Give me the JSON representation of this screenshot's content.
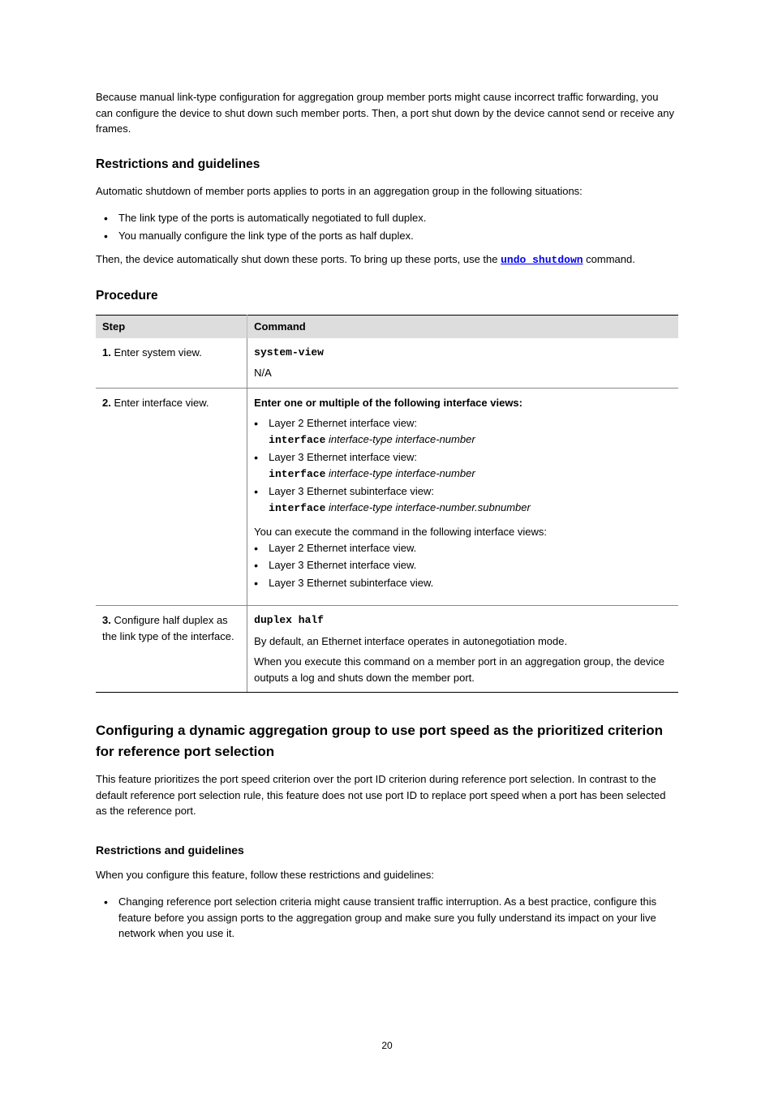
{
  "intro": "Because manual link-type configuration for aggregation group member ports might cause incorrect traffic forwarding, you can configure the device to shut down such member ports. Then, a port shut down by the device cannot send or receive any frames.",
  "section1": {
    "title": "Restrictions and guidelines",
    "para1": "Automatic shutdown of member ports applies to ports in an aggregation group in the following situations:",
    "bullets": [
      "The link type of the ports is automatically negotiated to full duplex.",
      "You manually configure the link type of the ports as half duplex."
    ],
    "after_prefix": "Then, the device automatically shut down these ports. To bring up these ports, use the ",
    "after_cmd": "undo shutdown",
    "after_suffix": " command."
  },
  "section2": {
    "title": "Procedure",
    "table": {
      "col1": "Step",
      "col2": "Command",
      "rows": [
        {
          "step_n": "1.",
          "step_label": "Enter system view.",
          "cmd": "system-view",
          "desc": "N/A"
        },
        {
          "step_n": "2.",
          "step_label": "Enter interface view.",
          "cmd_head": "Enter one or multiple of the following interface views:",
          "items": [
            {
              "label": "Layer 2 Ethernet interface view:",
              "code": "interface interface-type interface-number"
            },
            {
              "label": "Layer 3 Ethernet interface view:",
              "code": "interface interface-type interface-number"
            },
            {
              "label": "Layer 3 Ethernet subinterface view:",
              "code": "interface interface-type interface-number.subnumber"
            }
          ],
          "desc_head": "You can execute the command in the following interface views:",
          "desc_items": [
            "Layer 2 Ethernet interface view.",
            "Layer 3 Ethernet interface view.",
            "Layer 3 Ethernet subinterface view."
          ]
        },
        {
          "step_n": "3.",
          "step_label": "Configure half duplex as the link type of the interface.",
          "cmd": "duplex half",
          "desc_p1": "By default, an Ethernet interface operates in autonegotiation mode.",
          "desc_p2": "When you execute this command on a member port in an aggregation group, the device outputs a log and shuts down the member port."
        }
      ]
    }
  },
  "section3": {
    "title": "Configuring a dynamic aggregation group to use port speed as the prioritized criterion for reference port selection",
    "para": "This feature prioritizes the port speed criterion over the port ID criterion during reference port selection. In contrast to the default reference port selection rule, this feature does not use port ID to replace port speed when a port has been selected as the reference port."
  },
  "section4": {
    "title": "Restrictions and guidelines",
    "para1": "When you configure this feature, follow these restrictions and guidelines:",
    "bullet": "Changing reference port selection criteria might cause transient traffic interruption. As a best practice, configure this feature before you assign ports to the aggregation group and make sure you fully understand its impact on your live network when you use it."
  },
  "page_number": "20"
}
